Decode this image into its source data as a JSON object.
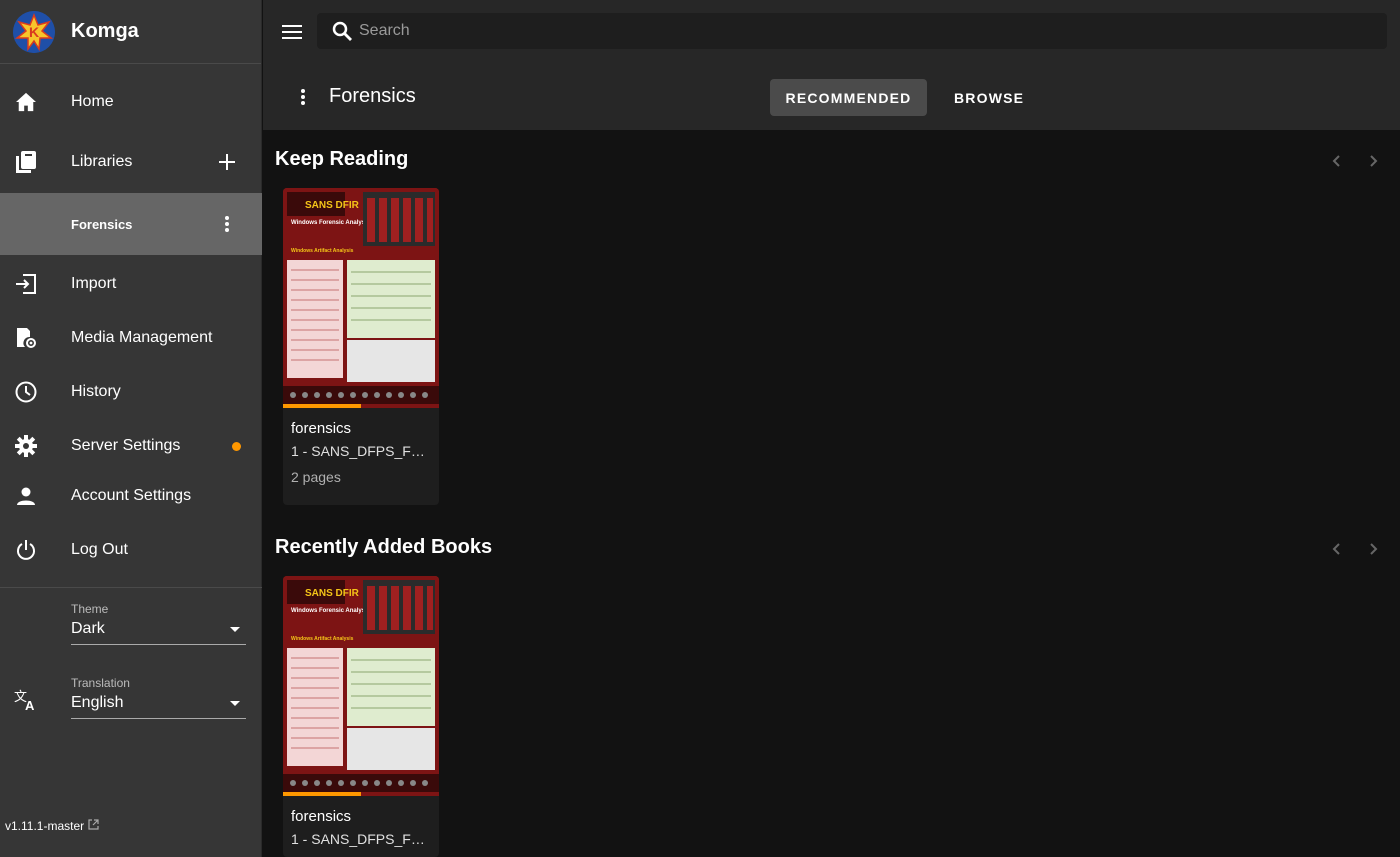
{
  "app": {
    "name": "Komga",
    "version": "v1.11.1-master"
  },
  "sidebar": {
    "items": [
      {
        "label": "Home",
        "icon": "home-icon"
      },
      {
        "label": "Libraries",
        "icon": "libraries-icon"
      },
      {
        "label": "Forensics",
        "icon": ""
      },
      {
        "label": "Import",
        "icon": "import-icon"
      },
      {
        "label": "Media Management",
        "icon": "media-management-icon"
      },
      {
        "label": "History",
        "icon": "history-icon"
      },
      {
        "label": "Server Settings",
        "icon": "gear-icon"
      },
      {
        "label": "Account Settings",
        "icon": "account-icon"
      },
      {
        "label": "Log Out",
        "icon": "power-icon"
      }
    ],
    "theme": {
      "caption": "Theme",
      "value": "Dark"
    },
    "translation": {
      "caption": "Translation",
      "value": "English"
    }
  },
  "topbar": {
    "search_placeholder": "Search"
  },
  "library": {
    "title": "Forensics",
    "tabs": [
      {
        "label": "RECOMMENDED",
        "active": true
      },
      {
        "label": "BROWSE",
        "active": false
      }
    ]
  },
  "sections": [
    {
      "title": "Keep Reading",
      "books": [
        {
          "series": "forensics",
          "title": "1 - SANS_DFPS_FO...",
          "meta": "2 pages",
          "progress": 0.5
        }
      ]
    },
    {
      "title": "Recently Added Books",
      "books": [
        {
          "series": "forensics",
          "title": "1 - SANS_DFPS_FO...",
          "progress": 0.5
        }
      ]
    }
  ],
  "colors": {
    "accent": "#ff9800",
    "sidebar_bg": "#363636",
    "active_item": "#666666"
  }
}
